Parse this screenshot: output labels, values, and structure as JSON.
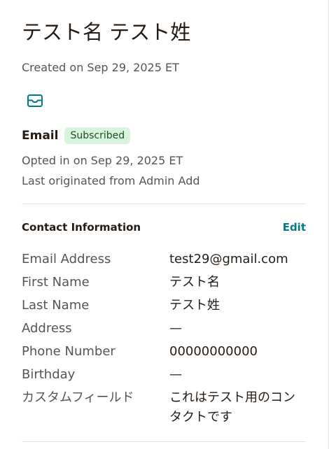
{
  "contact": {
    "name": "テスト名 テスト姓",
    "created": "Created on Sep 29, 2025 ET"
  },
  "email_status": {
    "heading": "Email",
    "badge": "Subscribed",
    "opted_in": "Opted in on Sep 29, 2025 ET",
    "originated": "Last originated from Admin Add"
  },
  "contact_info": {
    "title": "Contact Information",
    "edit_label": "Edit",
    "fields": [
      {
        "label": "Email Address",
        "value": "test29@gmail.com"
      },
      {
        "label": "First Name",
        "value": "テスト名"
      },
      {
        "label": "Last Name",
        "value": "テスト姓"
      },
      {
        "label": "Address",
        "value": "—"
      },
      {
        "label": "Phone Number",
        "value": "00000000000"
      },
      {
        "label": "Birthday",
        "value": "—"
      },
      {
        "label": "カスタムフィールド",
        "value": "これはテスト用のコンタクトです"
      }
    ]
  },
  "icons": {
    "email_channel": "envelope-icon"
  },
  "colors": {
    "accent": "#007c89",
    "badge_bg": "#d9f4dd",
    "badge_text": "#1f4d27"
  }
}
